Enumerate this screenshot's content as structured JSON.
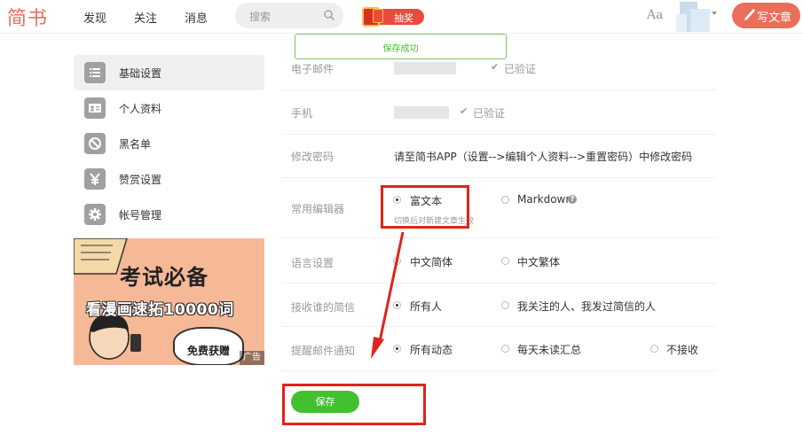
{
  "header": {
    "logo": "简书",
    "nav": [
      "发现",
      "关注",
      "消息"
    ],
    "search_placeholder": "搜索",
    "prize_label": "抽奖",
    "font_toggle": "Aa",
    "write_button": "写文章",
    "icons": [
      "search-icon",
      "red-envelope-icon",
      "pen-icon",
      "chevron-down-icon"
    ]
  },
  "toast": "保存成功",
  "sidebar": {
    "items": [
      {
        "label": "基础设置",
        "icon": "list-icon",
        "active": true
      },
      {
        "label": "个人资料",
        "icon": "profile-card-icon",
        "active": false
      },
      {
        "label": "黑名单",
        "icon": "block-icon",
        "active": false
      },
      {
        "label": "赞赏设置",
        "icon": "yen-icon",
        "active": false
      },
      {
        "label": "帐号管理",
        "icon": "gear-icon",
        "active": false
      }
    ],
    "ad": {
      "headline": "考试必备",
      "subline": "看漫画速拓10000词",
      "badge": "免费获赠",
      "tag": "广告"
    }
  },
  "settings": {
    "email": {
      "label": "电子邮件",
      "status": "已验证"
    },
    "phone": {
      "label": "手机",
      "status": "已验证"
    },
    "password": {
      "label": "修改密码",
      "value": "请至简书APP（设置-->编辑个人资料-->重置密码）中修改密码"
    },
    "editor": {
      "label": "常用编辑器",
      "options": [
        "富文本",
        "Markdown"
      ],
      "selected": "富文本",
      "hint": "切换后对新建文章生效"
    },
    "language": {
      "label": "语言设置",
      "options": [
        "中文简体",
        "中文繁体"
      ],
      "selected": "中文简体"
    },
    "messages": {
      "label": "接收谁的简信",
      "options": [
        "所有人",
        "我关注的人、我发过简信的人"
      ],
      "selected": "所有人"
    },
    "email_notify": {
      "label": "提醒邮件通知",
      "options": [
        "所有动态",
        "每天未读汇总",
        "不接收"
      ],
      "selected": "所有动态"
    }
  },
  "save_button": "保存",
  "colors": {
    "brand": "#ea6f5a",
    "save": "#42c02e",
    "annotation": "#e0241b"
  }
}
